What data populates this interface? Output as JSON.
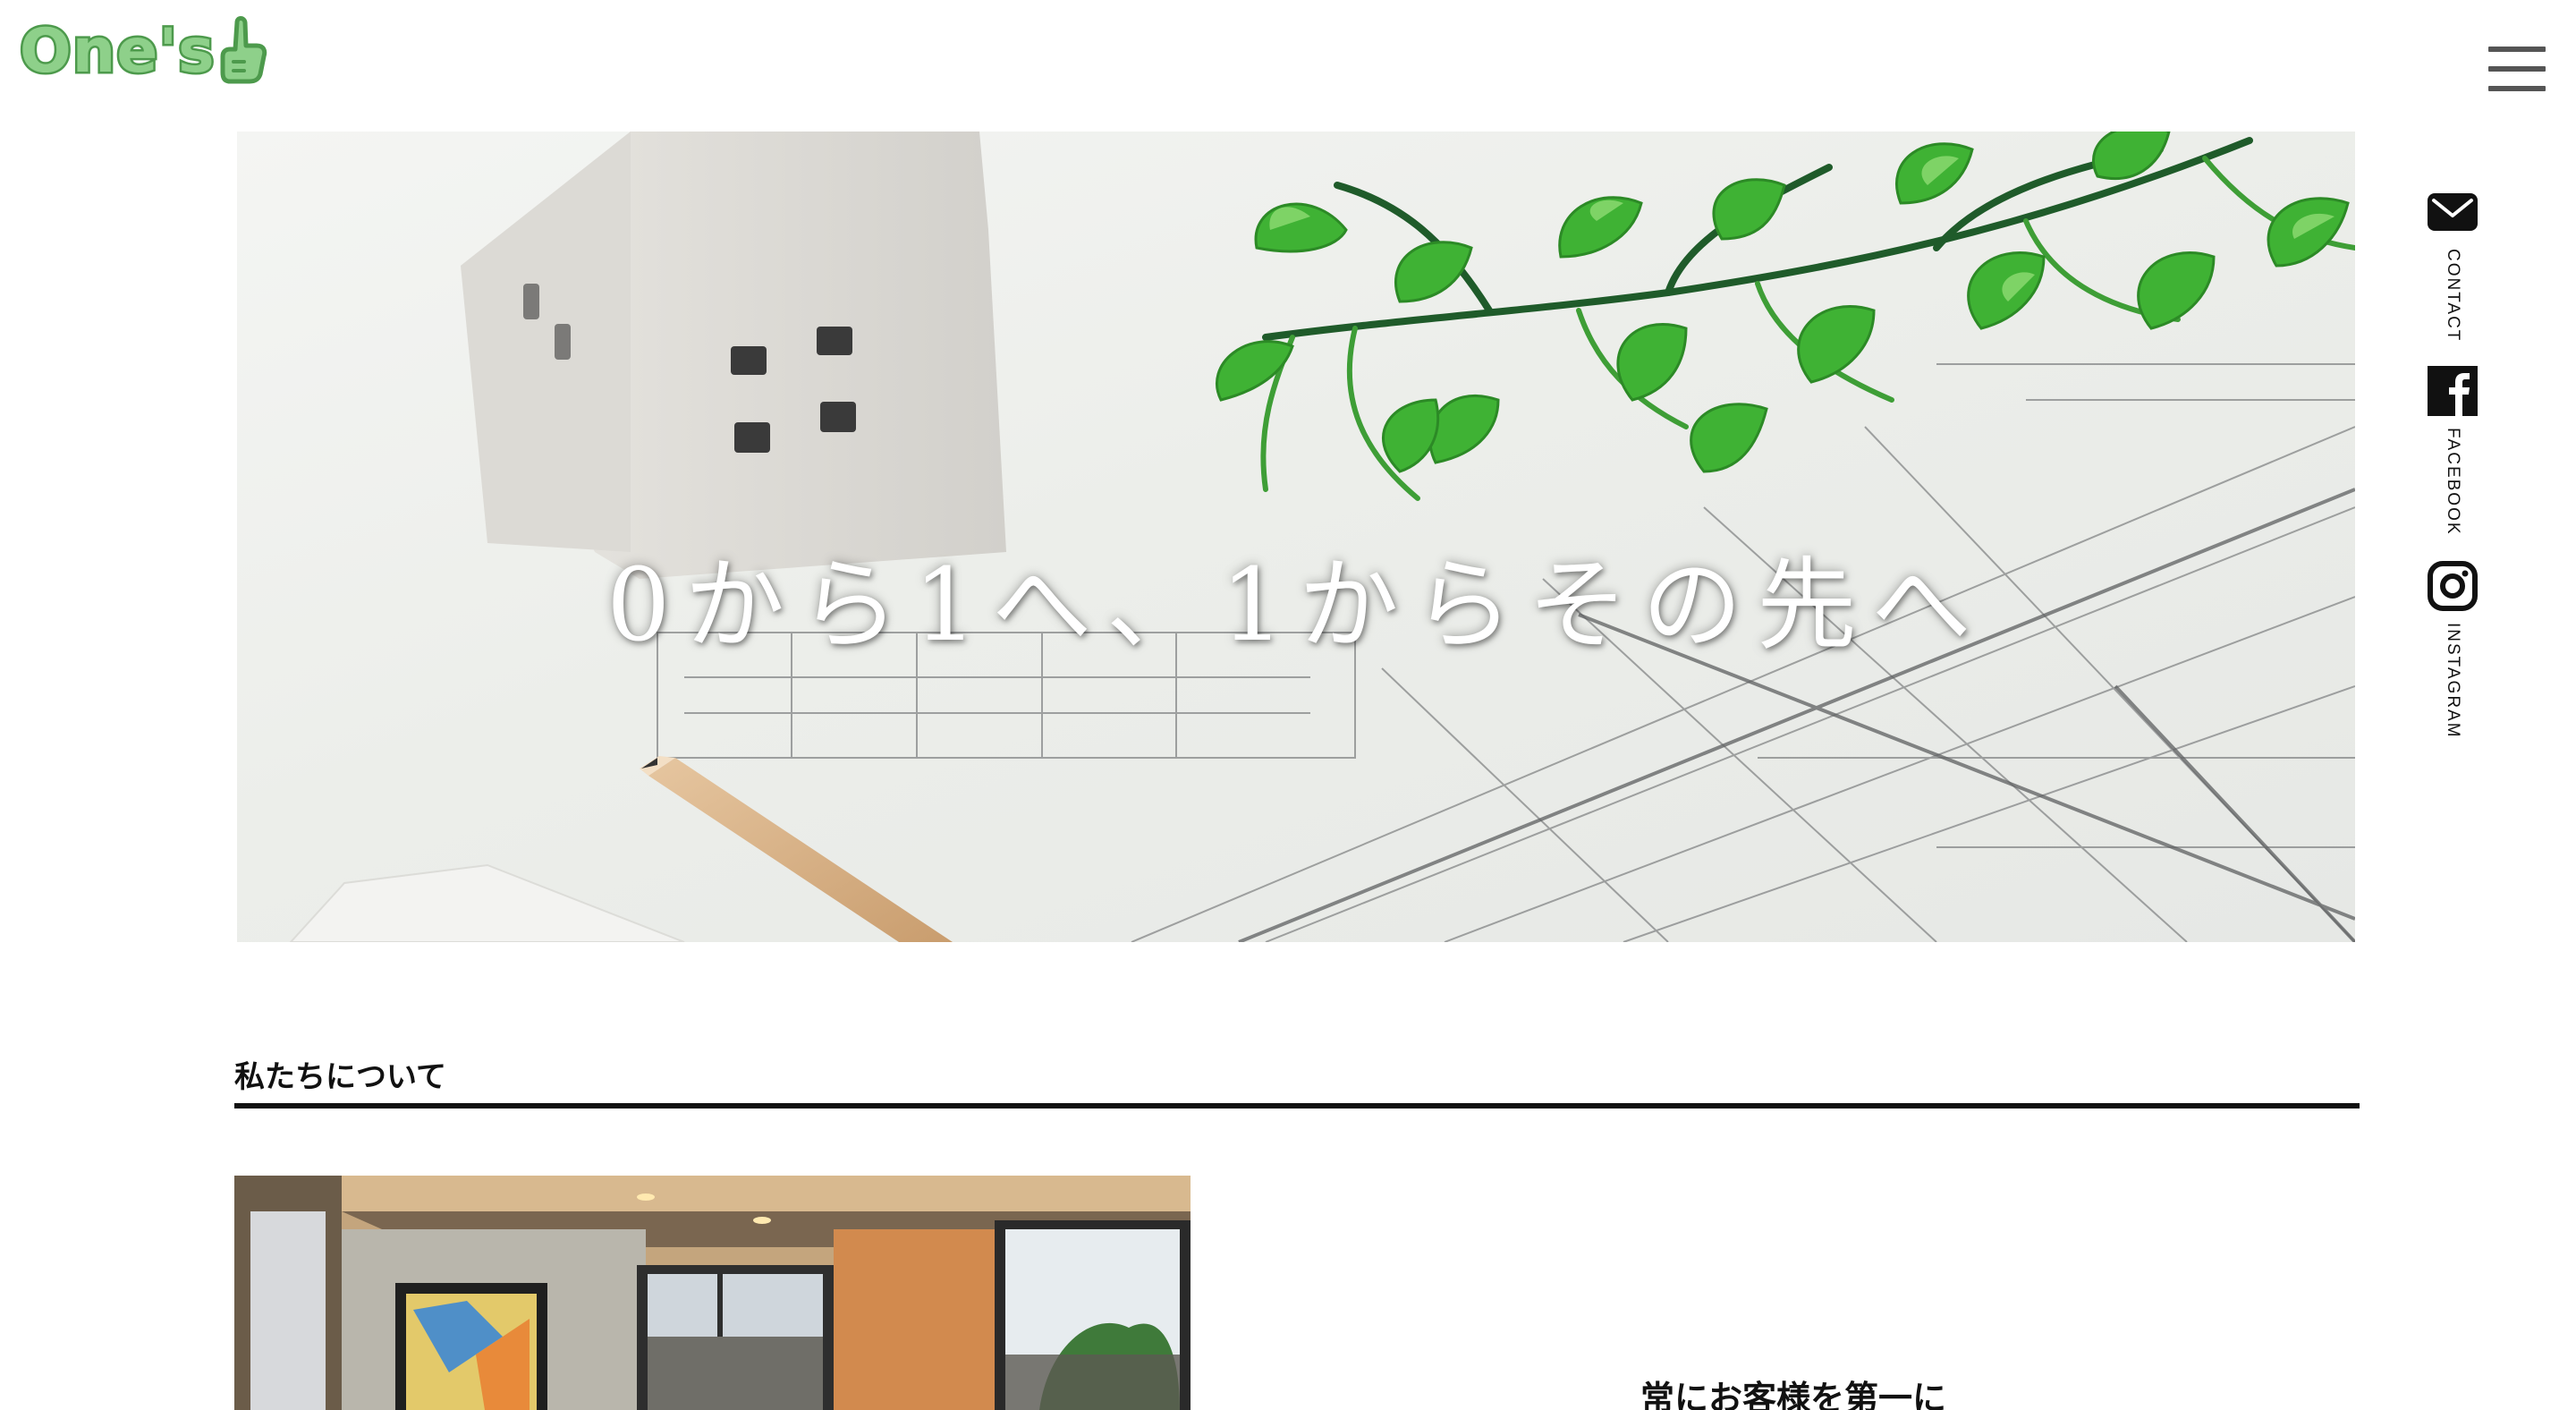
{
  "header": {
    "logo_text": "One's",
    "menu_icon": "hamburger-menu-icon"
  },
  "hero": {
    "headline": "0から1へ、1からその先へ"
  },
  "social": [
    {
      "icon": "mail-icon",
      "label": "CONTACT"
    },
    {
      "icon": "facebook-icon",
      "label": "FACEBOOK"
    },
    {
      "icon": "instagram-icon",
      "label": "INSTAGRAM"
    }
  ],
  "about": {
    "section_title": "私たちについて",
    "heading": "常にお客様を第一に"
  },
  "colors": {
    "logo_fill": "#8ed08a",
    "logo_stroke": "#4d9a4c",
    "text": "#111111",
    "background": "#ffffff"
  }
}
